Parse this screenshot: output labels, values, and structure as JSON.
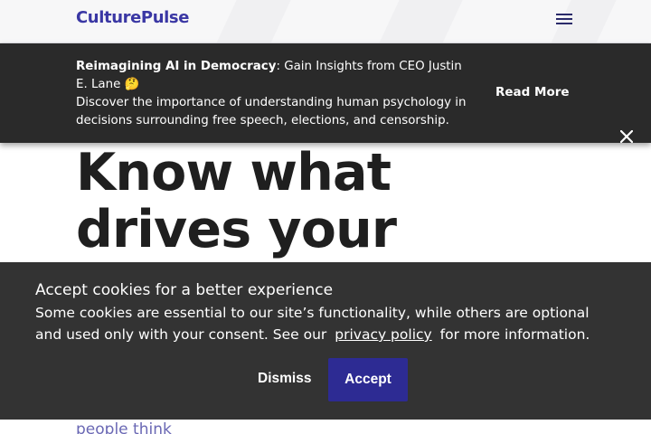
{
  "nav": {
    "logo": "CulturePulse",
    "menu_icon": "hamburger-menu-icon"
  },
  "banner": {
    "headline_bold": "Reimagining AI in Democracy",
    "headline_rest": ": Gain Insights from CEO Justin E. Lane",
    "headline_emoji": "🤔",
    "body": "Discover the importance of understanding human psychology in decisions surrounding free speech, elections, and censorship.",
    "read_more": "Read More",
    "close_icon": "close-icon"
  },
  "hero": {
    "line1": "Know what",
    "line2": "drives your",
    "subtitle_fragment": "people think"
  },
  "cookie": {
    "title": "Accept cookies for a better experience",
    "body_before": "Some cookies are essential to our site’s functionality, while others are optional and used only with your consent. See our",
    "link": "privacy policy",
    "body_after": "for more information.",
    "dismiss": "Dismiss",
    "accept": "Accept"
  },
  "colors": {
    "brand": "#3a37a4",
    "banner_bg": "#2a2a2a",
    "cookie_bg": "#333333",
    "accept_bg": "#2d2b93"
  }
}
